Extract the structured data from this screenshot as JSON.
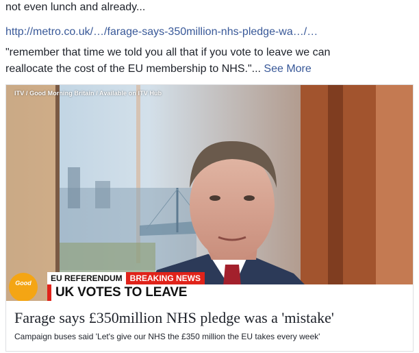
{
  "post": {
    "line1": "not even lunch and already...",
    "link": "http://metro.co.uk/…/farage-says-350million-nhs-pledge-wa…/…",
    "quote_line1": "\"remember that time we told you all that if you vote to leave we can",
    "quote_line2": "reallocate the cost of the EU membership to NHS.\"...",
    "see_more": "See More"
  },
  "card": {
    "credit": "ITV / Good Morning Britain / Available on ITV Hub",
    "logo_text": "Good",
    "strap_label": "EU REFERENDUM",
    "strap_breaking": "BREAKING NEWS",
    "strap_headline": "UK VOTES TO LEAVE",
    "title": "Farage says £350million NHS pledge was a 'mistake'",
    "description": "Campaign buses said 'Let's give our NHS the £350 million the EU takes every week'"
  },
  "colors": {
    "link": "#385898",
    "breaking_red": "#e0231a",
    "logo_orange": "#f4a514",
    "suit_navy": "#2c3a58",
    "tie_red": "#a3202c"
  }
}
